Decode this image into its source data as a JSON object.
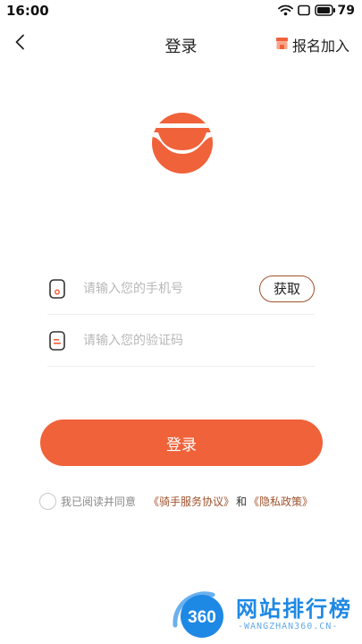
{
  "status_bar": {
    "time": "16:00",
    "battery_level": "79",
    "icons": [
      "wifi-icon",
      "sim-icon",
      "battery-icon"
    ]
  },
  "nav": {
    "title": "登录",
    "back_icon": "chevron-left-icon",
    "join_label": "报名加入",
    "join_icon": "store-icon"
  },
  "logo": {
    "icon": "app-logo-icon",
    "colors": {
      "primary": "#f0623a"
    }
  },
  "form": {
    "phone": {
      "placeholder": "请输入您的手机号",
      "value": "",
      "icon": "phone-icon"
    },
    "get_code_label": "获取",
    "code": {
      "placeholder": "请输入您的验证码",
      "value": "",
      "icon": "message-icon"
    }
  },
  "login_button": {
    "label": "登录"
  },
  "agreement": {
    "text": "我已阅读并同意",
    "link1": "《骑手服务协议》",
    "and": "和",
    "link2": "《隐私政策》",
    "checked": false
  },
  "watermark": {
    "badge": "360",
    "title": "网站排行榜",
    "subtitle": "-WANGZHAN360.CN-"
  },
  "colors": {
    "accent": "#f0623a",
    "link": "#a0522d",
    "watermark": "#1e88e5"
  }
}
